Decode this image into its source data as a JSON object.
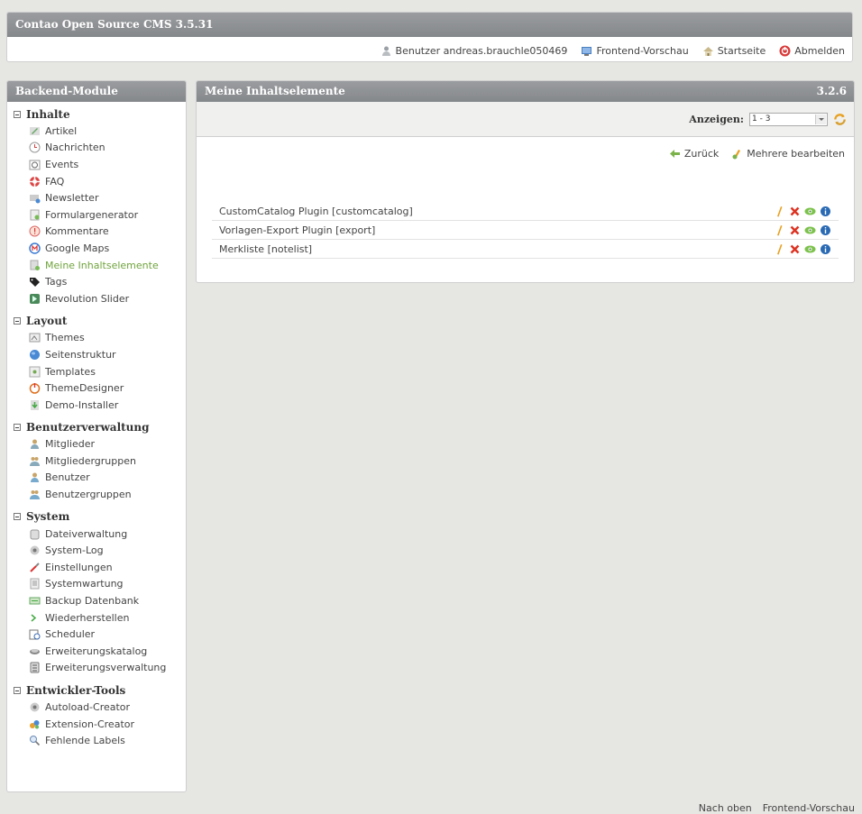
{
  "header": {
    "title": "Contao Open Source CMS 3.5.31",
    "links": [
      {
        "label": "Benutzer andreas.brauchle050469",
        "icon": "user-icon"
      },
      {
        "label": "Frontend-Vorschau",
        "icon": "monitor-icon"
      },
      {
        "label": "Startseite",
        "icon": "home-icon"
      },
      {
        "label": "Abmelden",
        "icon": "logout-icon"
      }
    ]
  },
  "sidebar": {
    "title": "Backend-Module",
    "groups": [
      {
        "title": "Inhalte",
        "items": [
          {
            "label": "Artikel",
            "icon": "article-icon"
          },
          {
            "label": "Nachrichten",
            "icon": "clock-icon"
          },
          {
            "label": "Events",
            "icon": "calendar-icon"
          },
          {
            "label": "FAQ",
            "icon": "lifebuoy-icon"
          },
          {
            "label": "Newsletter",
            "icon": "newsletter-icon"
          },
          {
            "label": "Formulargenerator",
            "icon": "form-icon"
          },
          {
            "label": "Kommentare",
            "icon": "comment-icon"
          },
          {
            "label": "Google Maps",
            "icon": "maps-icon"
          },
          {
            "label": "Meine Inhaltselemente",
            "icon": "content-elements-icon",
            "active": true
          },
          {
            "label": "Tags",
            "icon": "tag-icon"
          },
          {
            "label": "Revolution Slider",
            "icon": "slider-icon"
          }
        ]
      },
      {
        "title": "Layout",
        "items": [
          {
            "label": "Themes",
            "icon": "themes-icon"
          },
          {
            "label": "Seitenstruktur",
            "icon": "globe-icon"
          },
          {
            "label": "Templates",
            "icon": "templates-icon"
          },
          {
            "label": "ThemeDesigner",
            "icon": "power-icon"
          },
          {
            "label": "Demo-Installer",
            "icon": "installer-icon"
          }
        ]
      },
      {
        "title": "Benutzerverwaltung",
        "items": [
          {
            "label": "Mitglieder",
            "icon": "member-icon"
          },
          {
            "label": "Mitgliedergruppen",
            "icon": "member-group-icon"
          },
          {
            "label": "Benutzer",
            "icon": "user-icon"
          },
          {
            "label": "Benutzergruppen",
            "icon": "user-group-icon"
          }
        ]
      },
      {
        "title": "System",
        "items": [
          {
            "label": "Dateiverwaltung",
            "icon": "files-icon"
          },
          {
            "label": "System-Log",
            "icon": "log-icon"
          },
          {
            "label": "Einstellungen",
            "icon": "settings-icon"
          },
          {
            "label": "Systemwartung",
            "icon": "maintenance-icon"
          },
          {
            "label": "Backup Datenbank",
            "icon": "backup-icon"
          },
          {
            "label": "Wiederherstellen",
            "icon": "restore-icon"
          },
          {
            "label": "Scheduler",
            "icon": "scheduler-icon"
          },
          {
            "label": "Erweiterungskatalog",
            "icon": "catalog-icon"
          },
          {
            "label": "Erweiterungsverwaltung",
            "icon": "extension-manager-icon"
          }
        ]
      },
      {
        "title": "Entwickler-Tools",
        "items": [
          {
            "label": "Autoload-Creator",
            "icon": "autoload-icon"
          },
          {
            "label": "Extension-Creator",
            "icon": "extension-creator-icon"
          },
          {
            "label": "Fehlende Labels",
            "icon": "search-icon"
          }
        ]
      }
    ]
  },
  "main": {
    "title": "Meine Inhaltselemente",
    "version": "3.2.6",
    "filter": {
      "label": "Anzeigen:",
      "selected": "1 - 3"
    },
    "actions": {
      "back": "Zurück",
      "edit_multiple": "Mehrere bearbeiten"
    },
    "rows": [
      {
        "label": "CustomCatalog Plugin [customcatalog]"
      },
      {
        "label": "Vorlagen-Export Plugin [export]"
      },
      {
        "label": "Merkliste [notelist]"
      }
    ]
  },
  "footer": {
    "top": "Nach oben",
    "preview": "Frontend-Vorschau"
  },
  "colors": {
    "header_bar": "#8b8e91",
    "active_link": "#6fa33c",
    "background": "#e6e6e3"
  }
}
